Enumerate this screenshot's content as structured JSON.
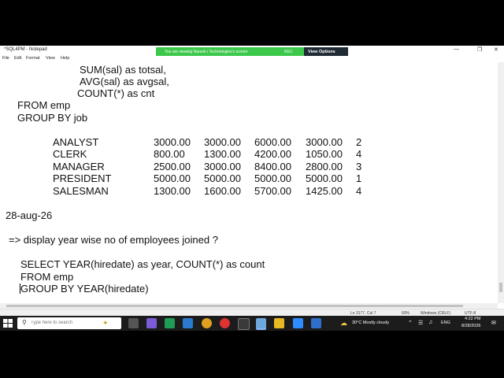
{
  "window": {
    "title": "*SQL4PM - Notepad"
  },
  "share_bar": {
    "message": "You are viewing Naresh i Technologies's screen",
    "rec": "REC",
    "view_options": "View Options"
  },
  "menu": [
    "File",
    "Edit",
    "Format",
    "View",
    "Help"
  ],
  "editor": {
    "lines": [
      {
        "text": "SUM(sal) as totsal,"
      },
      {
        "text": "AVG(sal) as avgsal,"
      },
      {
        "text": "COUNT(*) as cnt"
      },
      {
        "text": "FROM emp"
      },
      {
        "text": "GROUP BY job"
      }
    ],
    "result_rows": [
      {
        "job": "ANALYST",
        "c1": "3000.00",
        "c2": "3000.00",
        "c3": "6000.00",
        "c4": "3000.00",
        "c5": "2"
      },
      {
        "job": "CLERK",
        "c1": "800.00",
        "c2": "1300.00",
        "c3": "4200.00",
        "c4": "1050.00",
        "c5": "4"
      },
      {
        "job": "MANAGER",
        "c1": "2500.00",
        "c2": "3000.00",
        "c3": "8400.00",
        "c4": "2800.00",
        "c5": "3"
      },
      {
        "job": "PRESIDENT",
        "c1": "5000.00",
        "c2": "5000.00",
        "c3": "5000.00",
        "c4": "5000.00",
        "c5": "1"
      },
      {
        "job": "SALESMAN",
        "c1": "1300.00",
        "c2": "1600.00",
        "c3": "5700.00",
        "c4": "1425.00",
        "c5": "4"
      }
    ],
    "date_line": "28-aug-26",
    "question": "=> display year wise no of employees joined ?",
    "query": [
      "SELECT YEAR(hiredate) as year, COUNT(*) as count",
      "FROM emp",
      "GROUP BY YEAR(hiredate)"
    ]
  },
  "status": {
    "position": "Ln 3177, Col 7",
    "zoom": "60%",
    "line_ending": "Windows (CRLF)",
    "encoding": "UTF-8"
  },
  "taskbar": {
    "search_placeholder": "Type here to search",
    "weather": "30°C  Mostly cloudy",
    "language": "ENG",
    "time": "4:22 PM",
    "date": "8/28/2026"
  }
}
